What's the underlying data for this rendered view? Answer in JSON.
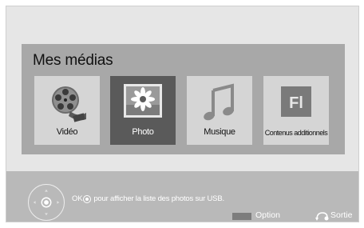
{
  "panel": {
    "title": "Mes médias"
  },
  "tiles": [
    {
      "label": "Vidéo",
      "icon": "film-reel-icon",
      "selected": false
    },
    {
      "label": "Photo",
      "icon": "photo-flower-icon",
      "selected": true
    },
    {
      "label": "Musique",
      "icon": "music-note-icon",
      "selected": false
    },
    {
      "label": "Contenus additionnels",
      "icon": "flash-content-icon",
      "icon_text": "Fl",
      "selected": false
    }
  ],
  "bottom_bar": {
    "hint_ok": "OK",
    "hint_text": "pour afficher la liste des photos sur USB.",
    "option_label": "Option",
    "exit_label": "Sortie"
  },
  "colors": {
    "selected_tile": "#5a5a5a",
    "tile": "#d5d5d5",
    "panel": "#a8a8a8",
    "bottom_bar": "#b9b9b9"
  }
}
